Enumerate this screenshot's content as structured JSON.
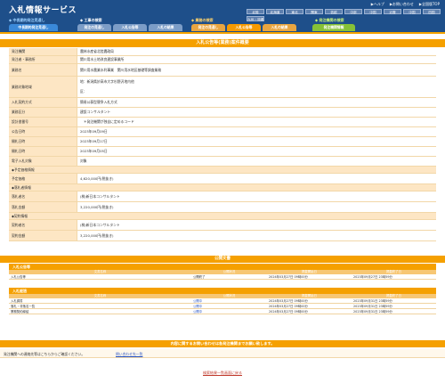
{
  "header": {
    "logo": "入札情報サービス",
    "util_links": [
      "▶ヘルプ",
      "▶お問い合わせ",
      "▶全国版TOP"
    ],
    "regions": [
      "北陸",
      "北海道",
      "東北",
      "関東",
      "信越",
      "中部",
      "中国",
      "近畿",
      "中国",
      "四国",
      "九州・沖縄"
    ]
  },
  "nav": {
    "labels": [
      "◆ 中長期的発注見通し",
      "◆ 工事の検索",
      "◆ 業務の検索",
      "◆ 発注機関の検索"
    ],
    "tabs": [
      "中長期的発注見通し",
      "発注の見通し",
      "入札公告等",
      "入札の結果",
      "発注の見通し",
      "入札公告等",
      "入札の結果",
      "発注機関情報"
    ]
  },
  "notice": {
    "title": "入札公告等(業務)案件概要",
    "rows": [
      {
        "label": "発注機関",
        "value": "農林水産省北陸農政局"
      },
      {
        "label": "発注者・事務所",
        "value": "関川用水土地改良建設事業所"
      },
      {
        "label": "業務名",
        "value": "関川用水農業水利事業　関川用水地区基礎等調査業務"
      },
      {
        "label": "業務対象地域",
        "value": "地：新潟県妙高市大字杉野沢地内他",
        "value2": "区："
      },
      {
        "label": "入札契約方式",
        "value": "簡易公募型競争入札方式"
      },
      {
        "label": "業務区分",
        "value": "建設コンサルタント"
      },
      {
        "label": "設計書番号",
        "value": "　＊発注機関が独自に定めるコード"
      },
      {
        "label": "公告日時",
        "value": "2023年09月09日"
      },
      {
        "label": "開札日時",
        "value": "2023年09月17日"
      },
      {
        "label": "開札日時",
        "value": "2023年09月05日"
      },
      {
        "label": "電子入札対象",
        "value": "対象"
      }
    ],
    "sections": {
      "planned": "◆予定価格情報",
      "bidder": "◆落札者情報",
      "contract": "◆契約情報"
    },
    "planned_rows": [
      {
        "label": "予定価格",
        "value": "4,620,000円(税抜き)"
      }
    ],
    "bidder_rows": [
      {
        "label": "落札者名",
        "value": "(株)新日本コンサルタント"
      },
      {
        "label": "落札金額",
        "value": "3,220,000円(税抜き)"
      }
    ],
    "contract_rows": [
      {
        "label": "契約者名",
        "value": "(株)新日本コンサルタント"
      },
      {
        "label": "契約金額",
        "value": "3,220,000円(税抜き)"
      }
    ]
  },
  "documents": {
    "title": "公開文書",
    "columns": [
      "文書名称",
      "公開状況",
      "掲載開始日",
      "掲載終了日"
    ],
    "notice_group": {
      "label": "入札公告等",
      "rows": [
        {
          "name": "入札公告等",
          "status": "公開終了",
          "start": "2024年03月27日 09時00分",
          "end": "2023年09月27日 23時59分"
        }
      ]
    },
    "result_group": {
      "label": "入札経過",
      "rows": [
        {
          "name": "入札調書",
          "status": "公開中",
          "start": "2024年03月27日 09時00分",
          "end": "2023年09月31日 23時59分"
        },
        {
          "name": "落札・非落名一覧",
          "status": "公開中",
          "start": "2024年03月27日 09時00分",
          "end": "2023年09月31日 23時59分"
        },
        {
          "name": "業務契約締結",
          "status": "公開中",
          "start": "2024年03月27日 09時00分",
          "end": "2023年09月31日 23時59分"
        }
      ]
    }
  },
  "contact": {
    "bar": "内容に関するお問い合わせは各発注機関までお願い致します。",
    "text": "発注機関への連絡先等はこちらからご確認ください。",
    "link": "問い合わせ先一覧"
  },
  "back_link": "検索結果一覧画面に戻る",
  "colors": {
    "header": "#1e4f8a",
    "accent": "#f5a000",
    "label_bg": "#fde6c4",
    "link": "#2a55c4"
  }
}
